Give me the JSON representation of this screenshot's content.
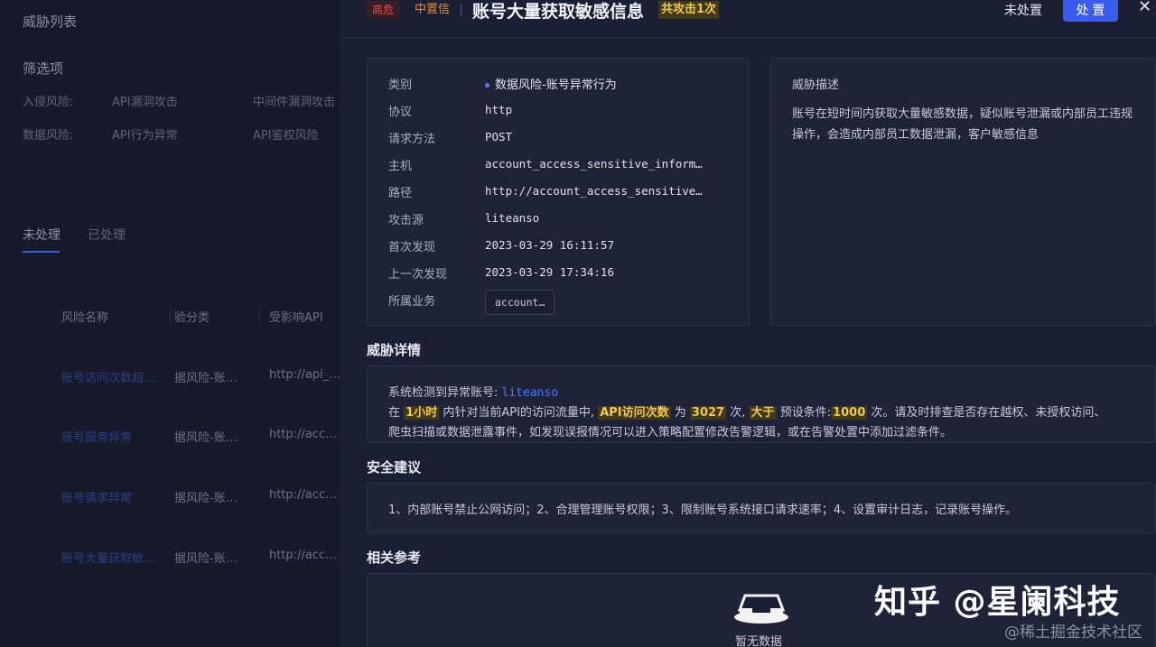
{
  "left": {
    "title": "威胁列表",
    "filter_title": "筛选项",
    "filters": [
      {
        "label": "入侵风险:",
        "opt1": "API漏洞攻击",
        "opt2": "中间件漏洞攻击"
      },
      {
        "label": "数据风险:",
        "opt1": "API行为异常",
        "opt2": "API鉴权风险"
      }
    ],
    "tabs": {
      "active": "未处理",
      "other": "已处理"
    },
    "columns": {
      "name": "风险名称",
      "category": "验分类",
      "api": "受影响API"
    },
    "rows": [
      {
        "name": "账号访问次数超…",
        "category": "据风险-账…",
        "api": "http://api_…"
      },
      {
        "name": "账号服务异常",
        "category": "据风险-账…",
        "api": "http://acc…"
      },
      {
        "name": "账号请求异常",
        "category": "据风险-账…",
        "api": "http://acc…"
      },
      {
        "name": "账号大量获取敏…",
        "category": "据风险-账…",
        "api": "http://acc…"
      }
    ]
  },
  "drawer": {
    "level_tag": "高危",
    "confidence_tag": "中置信",
    "title": "账号大量获取敏感信息",
    "attack_count": "共攻击1次",
    "status": "未处置",
    "handle_button": "处 置",
    "close_icon": "close-icon",
    "info": [
      {
        "label": "类别",
        "value": "数据风险-账号异常行为"
      },
      {
        "label": "协议",
        "value": "http"
      },
      {
        "label": "请求方法",
        "value": "POST"
      },
      {
        "label": "主机",
        "value": "account_access_sensitive_inform…"
      },
      {
        "label": "路径",
        "value": "http://account_access_sensitive…"
      },
      {
        "label": "攻击源",
        "value": "liteanso"
      },
      {
        "label": "首次发现",
        "value": "2023-03-29 16:11:57"
      },
      {
        "label": "上一次发现",
        "value": "2023-03-29 17:34:16"
      },
      {
        "label": "所属业务",
        "value": "account…"
      }
    ],
    "description": {
      "title": "威胁描述",
      "text": "账号在短时间内获取大量敏感数据，疑似账号泄漏或内部员工违规操作，会造成内部员工数据泄漏，客户敏感信息"
    },
    "detail": {
      "title": "威胁详情",
      "line1_prefix": "系统检测到异常账号:",
      "account": "liteanso",
      "l2_p1": "在",
      "l2_h1": "1小时",
      "l2_p2": "内针对当前API的访问流量中,",
      "l2_h2": "API访问次数",
      "l2_p3": "为",
      "l2_h3": "3027",
      "l2_p4": "次,",
      "l2_h4": "大于",
      "l2_p5": "预设条件:",
      "l2_h5": "1000",
      "l2_p6": "次。请及时排查是否存在越权、未授权访问、",
      "line3": "爬虫扫描或数据泄露事件，如发现误报情况可以进入策略配置修改告警逻辑，或在告警处置中添加过滤条件。"
    },
    "advice": {
      "title": "安全建议",
      "text": "1、内部账号禁止公网访问；2、合理管理账号权限；3、限制账号系统接口请求速率；4、设置审计日志，记录账号操作。"
    },
    "reference": {
      "title": "相关参考",
      "empty_text": "暂无数据"
    }
  },
  "watermark": {
    "main": "知乎 @星阑科技",
    "sub": "@稀土掘金技术社区"
  },
  "colors": {
    "accent": "#3b5cf0",
    "danger": "#e0524f",
    "warning": "#e08a2f",
    "highlight": "#f0c74a"
  }
}
